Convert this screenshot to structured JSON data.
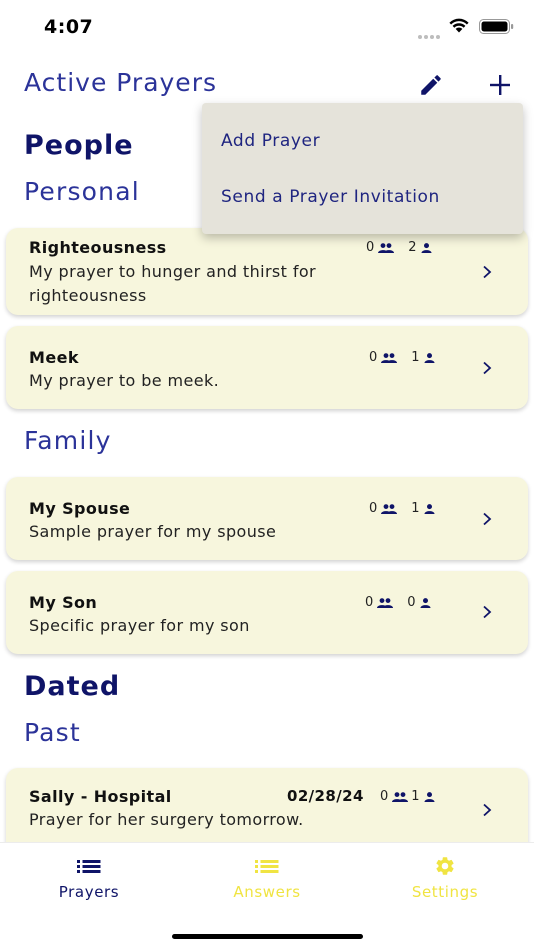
{
  "status": {
    "time": "4:07"
  },
  "header": {
    "title": "Active Prayers"
  },
  "menu": {
    "items": [
      "Add Prayer",
      "Send a Prayer Invitation"
    ]
  },
  "sections": {
    "people": "People",
    "personal": "Personal",
    "family": "Family",
    "dated": "Dated",
    "past": "Past"
  },
  "cards": [
    {
      "title": "Righteousness",
      "desc": "My prayer to hunger and thirst for righteousness",
      "group_count": "0",
      "person_count": "2"
    },
    {
      "title": "Meek",
      "desc": "My prayer to be meek.",
      "group_count": "0",
      "person_count": "1"
    },
    {
      "title": "My Spouse",
      "desc": "Sample prayer for my spouse",
      "group_count": "0",
      "person_count": "1"
    },
    {
      "title": "My Son",
      "desc": "Specific prayer for my son",
      "group_count": "0",
      "person_count": "0"
    },
    {
      "title": "Sally - Hospital",
      "date": "02/28/24",
      "desc": "Prayer for her surgery tomorrow.",
      "group_count": "0",
      "person_count": "1"
    }
  ],
  "tabs": [
    {
      "label": "Prayers",
      "icon": "list-icon"
    },
    {
      "label": "Answers",
      "icon": "list-icon"
    },
    {
      "label": "Settings",
      "icon": "gear-icon"
    }
  ],
  "colors": {
    "primary": "#2b3399",
    "heading": "#0f1468",
    "card_bg": "#f7f6dd",
    "menu_bg": "#e5e3da",
    "inactive_tab": "#f0e442"
  }
}
